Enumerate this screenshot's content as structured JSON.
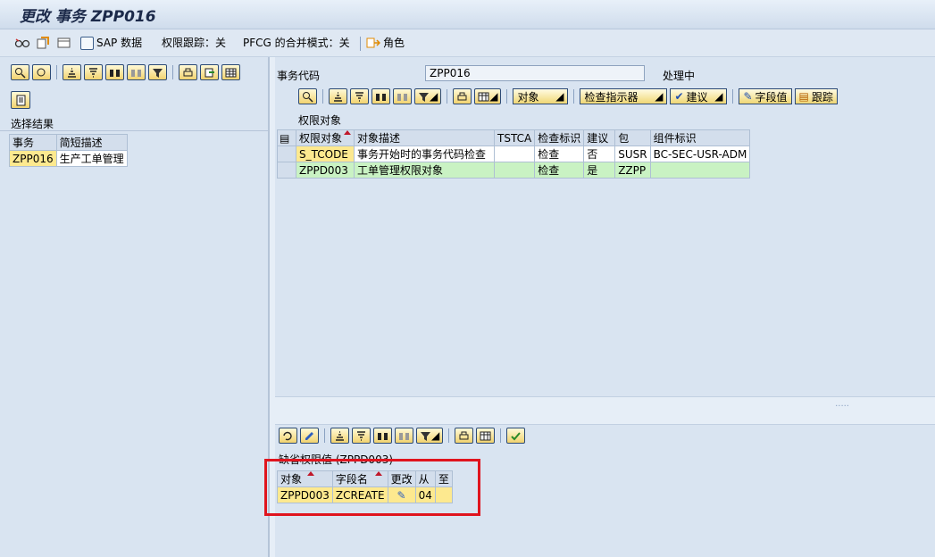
{
  "window": {
    "title": "更改 事务 ZPP016"
  },
  "toolbar": {
    "sap_data": "SAP 数据",
    "trace": "权限跟踪：关",
    "pfcg": "PFCG 的合并模式：关",
    "role": "角色"
  },
  "left": {
    "section_title": "选择结果",
    "columns": [
      "事务",
      "简短描述"
    ],
    "rows": [
      {
        "tcode": "ZPP016",
        "desc": "生产工单管理"
      }
    ]
  },
  "header": {
    "tcode_label": "事务代码",
    "tcode_value": "ZPP016",
    "status": "处理中"
  },
  "top_toolbar": {
    "object_dd": "对象",
    "check_ind_dd": "检查指示器",
    "proposal_dd": "建议",
    "field_value": "字段值",
    "trace": "跟踪"
  },
  "auth_objects": {
    "title": "权限对象",
    "columns": [
      "权限对象",
      "对象描述",
      "TSTCA",
      "检查标识",
      "建议",
      "包",
      "组件标识"
    ],
    "rows": [
      {
        "obj": "S_TCODE",
        "desc": "事务开始时的事务代码检查",
        "tstca": "",
        "check": "检查",
        "proposal": "否",
        "pkg": "SUSR",
        "comp": "BC-SEC-USR-ADM"
      },
      {
        "obj": "ZPPD003",
        "desc": "工单管理权限对象",
        "tstca": "",
        "check": "检查",
        "proposal": "是",
        "pkg": "ZZPP",
        "comp": ""
      }
    ]
  },
  "defaults": {
    "title": "缺省权限值 (ZPPD003)",
    "columns": [
      "对象",
      "字段名",
      "更改",
      "从",
      "至"
    ],
    "rows": [
      {
        "obj": "ZPPD003",
        "field": "ZCREATE",
        "from": "04",
        "to": ""
      }
    ]
  }
}
